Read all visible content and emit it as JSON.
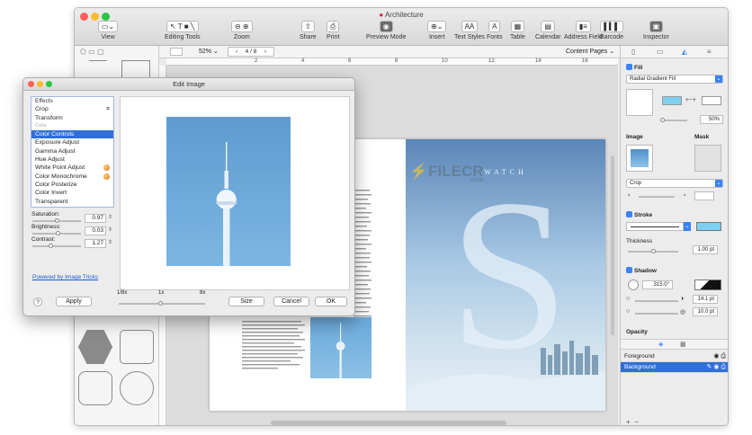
{
  "window": {
    "title": "Architecture"
  },
  "toolbar": [
    {
      "label": "View",
      "icon": "view-icon"
    },
    {
      "label": "Editing Tools",
      "icon": "editing-tools-icon"
    },
    {
      "label": "Zoom",
      "icon": "zoom-icon"
    },
    {
      "label": "Share",
      "icon": "share-icon"
    },
    {
      "label": "Print",
      "icon": "print-icon"
    },
    {
      "label": "Preview Mode",
      "icon": "eye-icon"
    },
    {
      "label": "Insert",
      "icon": "insert-icon"
    },
    {
      "label": "Text Styles",
      "icon": "text-styles-icon"
    },
    {
      "label": "Fonts",
      "icon": "fonts-icon"
    },
    {
      "label": "Table",
      "icon": "table-icon"
    },
    {
      "label": "Calendar",
      "icon": "calendar-icon"
    },
    {
      "label": "Address Field",
      "icon": "address-field-icon"
    },
    {
      "label": "Barcode",
      "icon": "barcode-icon"
    },
    {
      "label": "Inspector",
      "icon": "inspector-icon"
    }
  ],
  "formatbar": {
    "zoom": "52%",
    "page_indicator": "4 / 8",
    "content_pages": "Content Pages"
  },
  "ruler": {
    "h_ticks": [
      "2",
      "4",
      "6",
      "8",
      "10",
      "12",
      "14",
      "16",
      "18"
    ]
  },
  "document": {
    "poster_title": "WATCH",
    "poster_letter": "S"
  },
  "watermark": {
    "text": "FILECR",
    "sub": ".com"
  },
  "inspector": {
    "fill_label": "Fill",
    "fill_type": "Radial Gradient Fill",
    "fill_percent": "50%",
    "image_label": "Image",
    "mask_label": "Mask",
    "crop_label": "Crop",
    "stroke_label": "Stroke",
    "thickness_label": "Thickness",
    "thickness_value": "1.00 pt",
    "shadow_label": "Shadow",
    "shadow_angle": "315.0°",
    "shadow_offset": "14.1 pt",
    "shadow_blur": "10.0 pt",
    "opacity_label": "Opacity",
    "layers": [
      {
        "name": "Foreground",
        "selected": false
      },
      {
        "name": "Background",
        "selected": true
      }
    ],
    "add_label": "+",
    "remove_label": "−"
  },
  "dialog": {
    "title": "Edit Image",
    "effects_header": "Effects",
    "effects": [
      {
        "label": "Crop",
        "selected": false
      },
      {
        "label": "Transform",
        "selected": false
      },
      {
        "label": "Color",
        "selected": false,
        "muted": true
      },
      {
        "label": "Color Controls",
        "selected": true
      },
      {
        "label": "Exposure Adjust",
        "selected": false
      },
      {
        "label": "Gamma Adjust",
        "selected": false
      },
      {
        "label": "Hue Adjust",
        "selected": false
      },
      {
        "label": "White Point Adjust",
        "selected": false,
        "icon": true
      },
      {
        "label": "Color Monochrome",
        "selected": false,
        "icon": true
      },
      {
        "label": "Color Posterize",
        "selected": false
      },
      {
        "label": "Color Invert",
        "selected": false
      },
      {
        "label": "Transparent",
        "selected": false
      }
    ],
    "saturation_label": "Saturation:",
    "saturation_value": "0.97",
    "saturation_level": 0.5,
    "brightness_label": "Brightness:",
    "brightness_value": "0.03",
    "brightness_level": 0.52,
    "contrast_label": "Contrast:",
    "contrast_value": "1.27",
    "contrast_level": 0.35,
    "link": "Powered by Image Tricks",
    "zoom_labels": [
      "1/8x",
      "1x",
      "8x"
    ],
    "help": "?",
    "apply": "Apply",
    "size": "Size",
    "cancel": "Cancel",
    "ok": "OK"
  },
  "colors": {
    "accent": "#2f6fd7",
    "poster_top": "#5b86b8",
    "preview_sky": "#6aa8da"
  }
}
